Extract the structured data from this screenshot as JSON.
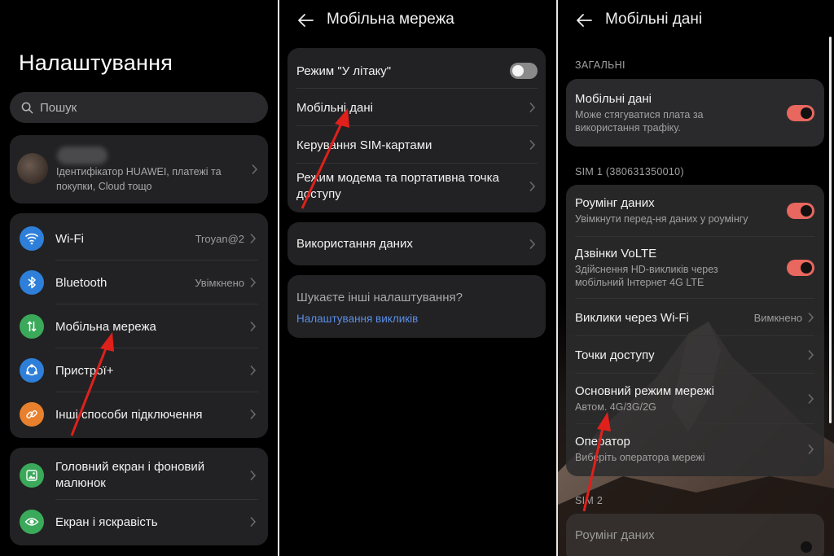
{
  "panel1": {
    "title": "Налаштування",
    "search_placeholder": "Пошук",
    "account": {
      "description": "Ідентифікатор HUAWEI, платежі та покупки, Cloud тощо"
    },
    "group1": [
      {
        "label": "Wi-Fi",
        "value": "Troyan@2",
        "icon": "wifi-icon",
        "color": "#2e7fd9"
      },
      {
        "label": "Bluetooth",
        "value": "Увімкнено",
        "icon": "bluetooth-icon",
        "color": "#2e7fd9"
      },
      {
        "label": "Мобільна мережа",
        "value": "",
        "icon": "mobile-network-icon",
        "color": "#3aa95a"
      },
      {
        "label": "Пристрої+",
        "value": "",
        "icon": "devices-plus-icon",
        "color": "#2e7fd9"
      },
      {
        "label": "Інші способи підключення",
        "value": "",
        "icon": "link-icon",
        "color": "#e8802d"
      }
    ],
    "group2": [
      {
        "label": "Головний екран і фоновий малюнок",
        "icon": "wallpaper-icon",
        "color": "#3aa95a"
      },
      {
        "label": "Екран і яскравість",
        "icon": "eye-icon",
        "color": "#3aa95a"
      }
    ]
  },
  "panel2": {
    "title": "Мобільна мережа",
    "card1": [
      {
        "label": "Режим \"У літаку\"",
        "type": "switch",
        "on": false
      },
      {
        "label": "Мобільні дані",
        "type": "link"
      },
      {
        "label": "Керування SIM-картами",
        "type": "link"
      },
      {
        "label": "Режим модема та портативна точка доступу",
        "type": "link"
      }
    ],
    "card2": [
      {
        "label": "Використання даних",
        "type": "link"
      }
    ],
    "card3": {
      "question": "Шукаєте інші налаштування?",
      "link": "Налаштування викликів"
    }
  },
  "panel3": {
    "title": "Мобільні дані",
    "section_general": "ЗАГАЛЬНІ",
    "general": {
      "label": "Мобільні дані",
      "sublabel": "Може стягуватися плата за використання трафіку.",
      "on": true
    },
    "section_sim1": "SIM 1 (380631350010)",
    "sim1": [
      {
        "label": "Роумінг даних",
        "sublabel": "Увімкнути перед-ня даних у роумінгу",
        "type": "switch",
        "on": true
      },
      {
        "label": "Дзвінки VoLTE",
        "sublabel": "Здійснення HD-викликів через мобільний Інтернет 4G LTE",
        "type": "switch",
        "on": true
      },
      {
        "label": "Виклики через Wi-Fi",
        "value": "Вимкнено",
        "type": "link"
      },
      {
        "label": "Точки доступу",
        "type": "link"
      },
      {
        "label": "Основний режим мережі",
        "sublabel": "Автом. 4G/3G/2G",
        "type": "link"
      },
      {
        "label": "Оператор",
        "sublabel": "Виберіть оператора мережі",
        "type": "link"
      }
    ],
    "section_sim2": "SIM 2",
    "sim2": [
      {
        "label": "Роумінг даних",
        "type": "switch",
        "on": false
      }
    ]
  },
  "colors": {
    "accent_link": "#5b8ee6",
    "switch_on": "#e8675e",
    "arrow": "#e0201b",
    "card_bg": "#222224"
  }
}
